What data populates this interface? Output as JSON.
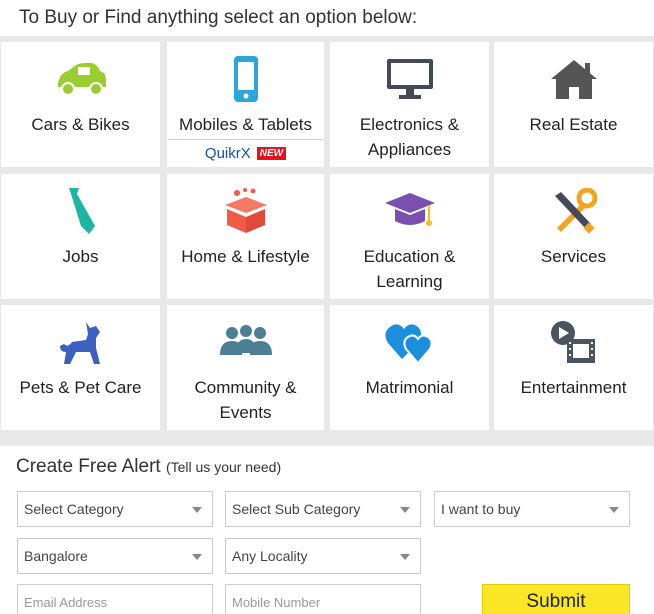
{
  "header": {
    "title": "To Buy or Find anything select an option below:"
  },
  "categories": [
    {
      "label": "Cars & Bikes",
      "icon": "car-icon",
      "color": "#9acd32"
    },
    {
      "label": "Mobiles & Tablets",
      "icon": "mobile-icon",
      "color": "#2aa7d6",
      "sub_label": "QuikrX",
      "badge": "NEW"
    },
    {
      "label": "Electronics & Appliances",
      "icon": "monitor-icon",
      "color": "#444a55"
    },
    {
      "label": "Real Estate",
      "icon": "home-icon",
      "color": "#555555"
    },
    {
      "label": "Jobs",
      "icon": "tie-icon",
      "color": "#1fb5a3"
    },
    {
      "label": "Home & Lifestyle",
      "icon": "gift-box-icon",
      "color": "#ef5b47"
    },
    {
      "label": "Education & Learning",
      "icon": "graduation-cap-icon",
      "color": "#7b4fb0"
    },
    {
      "label": "Services",
      "icon": "tools-icon",
      "color": "#f0a41f"
    },
    {
      "label": "Pets & Pet Care",
      "icon": "dog-icon",
      "color": "#3c5fc0"
    },
    {
      "label": "Community & Events",
      "icon": "people-icon",
      "color": "#4a7f95"
    },
    {
      "label": "Matrimonial",
      "icon": "hearts-icon",
      "color": "#1c8fdc"
    },
    {
      "label": "Entertainment",
      "icon": "film-icon",
      "color": "#4a5560"
    }
  ],
  "alert": {
    "title": "Create Free Alert",
    "hint": "(Tell us your need)",
    "category": "Select Category",
    "sub_category": "Select Sub Category",
    "intent": "I want to buy",
    "city": "Bangalore",
    "locality": "Any Locality",
    "email_placeholder": "Email Address",
    "mobile_placeholder": "Mobile Number",
    "submit_label": "Submit"
  }
}
